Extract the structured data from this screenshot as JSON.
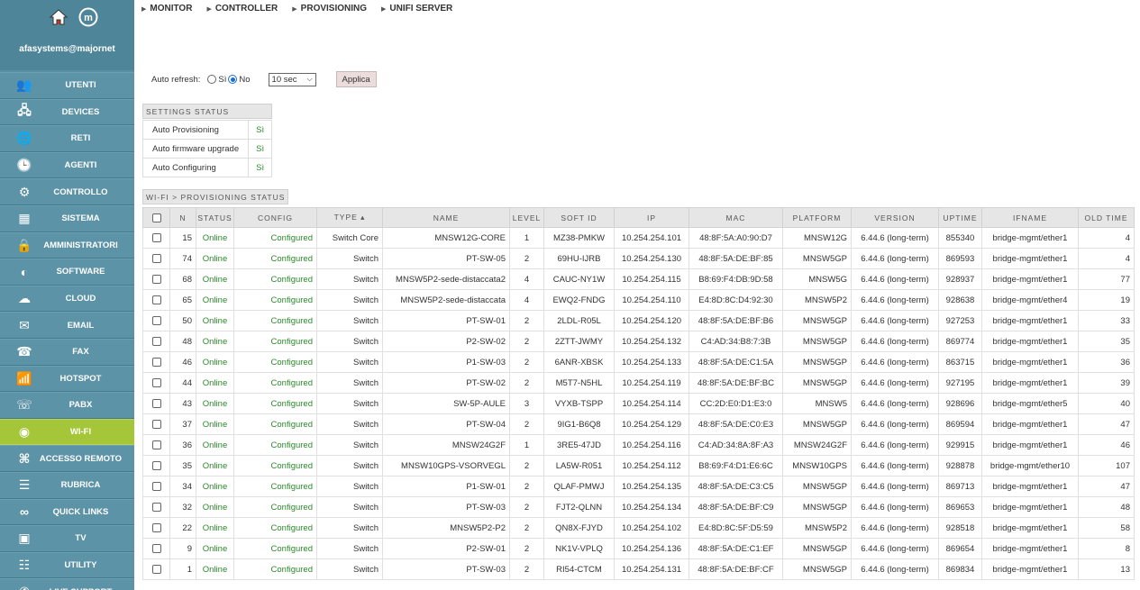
{
  "sidebar": {
    "user": "afasystems@majornet",
    "items": [
      {
        "label": "UTENTI",
        "icon": "users-icon"
      },
      {
        "label": "DEVICES",
        "icon": "devices-icon"
      },
      {
        "label": "RETI",
        "icon": "globe-icon"
      },
      {
        "label": "AGENTI",
        "icon": "clock-icon"
      },
      {
        "label": "CONTROLLO",
        "icon": "control-icon"
      },
      {
        "label": "SISTEMA",
        "icon": "system-icon"
      },
      {
        "label": "AMMINISTRATORI",
        "icon": "lock-icon"
      },
      {
        "label": "SOFTWARE",
        "icon": "software-icon"
      },
      {
        "label": "CLOUD",
        "icon": "cloud-icon"
      },
      {
        "label": "EMAIL",
        "icon": "email-icon"
      },
      {
        "label": "FAX",
        "icon": "fax-icon"
      },
      {
        "label": "HOTSPOT",
        "icon": "hotspot-icon"
      },
      {
        "label": "PABX",
        "icon": "phone-icon"
      },
      {
        "label": "WI-FI",
        "icon": "wifi-icon",
        "active": true
      },
      {
        "label": "ACCESSO REMOTO",
        "icon": "remote-icon"
      },
      {
        "label": "RUBRICA",
        "icon": "contacts-icon"
      },
      {
        "label": "QUICK LINKS",
        "icon": "link-icon"
      },
      {
        "label": "TV",
        "icon": "tv-icon"
      },
      {
        "label": "UTILITY",
        "icon": "utility-icon"
      },
      {
        "label": "LIVE SUPPORT",
        "icon": "support-icon"
      }
    ]
  },
  "topmenu": [
    "MONITOR",
    "CONTROLLER",
    "PROVISIONING",
    "UNIFI SERVER"
  ],
  "refresh": {
    "label": "Auto refresh:",
    "opt_yes": "Sì",
    "opt_no": "No",
    "selected": "No",
    "interval": "10 sec",
    "apply": "Applica"
  },
  "settings": {
    "title": "SETTINGS STATUS",
    "rows": [
      {
        "label": "Auto Provisioning",
        "value": "Sì"
      },
      {
        "label": "Auto firmware upgrade",
        "value": "Sì"
      },
      {
        "label": "Auto Configuring",
        "value": "Sì"
      }
    ]
  },
  "provisioning": {
    "title": "WI-FI > PROVISIONING STATUS",
    "columns": [
      "N",
      "STATUS",
      "CONFIG",
      "TYPE ▴",
      "NAME",
      "LEVEL",
      "SOFT ID",
      "IP",
      "MAC",
      "PLATFORM",
      "VERSION",
      "UPTIME",
      "IFNAME",
      "OLD TIME"
    ],
    "rows": [
      [
        "15",
        "Online",
        "Configured",
        "Switch Core",
        "MNSW12G-CORE",
        "1",
        "MZ38-PMKW",
        "10.254.254.101",
        "48:8F:5A:A0:90:D7",
        "MNSW12G",
        "6.44.6 (long-term)",
        "855340",
        "bridge-mgmt/ether1",
        "4"
      ],
      [
        "74",
        "Online",
        "Configured",
        "Switch",
        "PT-SW-05",
        "2",
        "69HU-IJRB",
        "10.254.254.130",
        "48:8F:5A:DE:BF:85",
        "MNSW5GP",
        "6.44.6 (long-term)",
        "869593",
        "bridge-mgmt/ether1",
        "4"
      ],
      [
        "68",
        "Online",
        "Configured",
        "Switch",
        "MNSW5P2-sede-distaccata2",
        "4",
        "CAUC-NY1W",
        "10.254.254.115",
        "B8:69:F4:DB:9D:58",
        "MNSW5G",
        "6.44.6 (long-term)",
        "928937",
        "bridge-mgmt/ether1",
        "77"
      ],
      [
        "65",
        "Online",
        "Configured",
        "Switch",
        "MNSW5P2-sede-distaccata",
        "4",
        "EWQ2-FNDG",
        "10.254.254.110",
        "E4:8D:8C:D4:92:30",
        "MNSW5P2",
        "6.44.6 (long-term)",
        "928638",
        "bridge-mgmt/ether4",
        "19"
      ],
      [
        "50",
        "Online",
        "Configured",
        "Switch",
        "PT-SW-01",
        "2",
        "2LDL-R05L",
        "10.254.254.120",
        "48:8F:5A:DE:BF:B6",
        "MNSW5GP",
        "6.44.6 (long-term)",
        "927253",
        "bridge-mgmt/ether1",
        "33"
      ],
      [
        "48",
        "Online",
        "Configured",
        "Switch",
        "P2-SW-02",
        "2",
        "2ZTT-JWMY",
        "10.254.254.132",
        "C4:AD:34:B8:7:3B",
        "MNSW5GP",
        "6.44.6 (long-term)",
        "869774",
        "bridge-mgmt/ether1",
        "35"
      ],
      [
        "46",
        "Online",
        "Configured",
        "Switch",
        "P1-SW-03",
        "2",
        "6ANR-XBSK",
        "10.254.254.133",
        "48:8F:5A:DE:C1:5A",
        "MNSW5GP",
        "6.44.6 (long-term)",
        "863715",
        "bridge-mgmt/ether1",
        "36"
      ],
      [
        "44",
        "Online",
        "Configured",
        "Switch",
        "PT-SW-02",
        "2",
        "M5T7-N5HL",
        "10.254.254.119",
        "48:8F:5A:DE:BF:BC",
        "MNSW5GP",
        "6.44.6 (long-term)",
        "927195",
        "bridge-mgmt/ether1",
        "39"
      ],
      [
        "43",
        "Online",
        "Configured",
        "Switch",
        "SW-5P-AULE",
        "3",
        "VYXB-TSPP",
        "10.254.254.114",
        "CC:2D:E0:D1:E3:0",
        "MNSW5",
        "6.44.6 (long-term)",
        "928696",
        "bridge-mgmt/ether5",
        "40"
      ],
      [
        "37",
        "Online",
        "Configured",
        "Switch",
        "PT-SW-04",
        "2",
        "9IG1-B6Q8",
        "10.254.254.129",
        "48:8F:5A:DE:C0:E3",
        "MNSW5GP",
        "6.44.6 (long-term)",
        "869594",
        "bridge-mgmt/ether1",
        "47"
      ],
      [
        "36",
        "Online",
        "Configured",
        "Switch",
        "MNSW24G2F",
        "1",
        "3RE5-47JD",
        "10.254.254.116",
        "C4:AD:34:8A:8F:A3",
        "MNSW24G2F",
        "6.44.6 (long-term)",
        "929915",
        "bridge-mgmt/ether1",
        "46"
      ],
      [
        "35",
        "Online",
        "Configured",
        "Switch",
        "MNSW10GPS-VSORVEGL",
        "2",
        "LA5W-R051",
        "10.254.254.112",
        "B8:69:F4:D1:E6:6C",
        "MNSW10GPS",
        "6.44.6 (long-term)",
        "928878",
        "bridge-mgmt/ether10",
        "107"
      ],
      [
        "34",
        "Online",
        "Configured",
        "Switch",
        "P1-SW-01",
        "2",
        "QLAF-PMWJ",
        "10.254.254.135",
        "48:8F:5A:DE:C3:C5",
        "MNSW5GP",
        "6.44.6 (long-term)",
        "869713",
        "bridge-mgmt/ether1",
        "47"
      ],
      [
        "32",
        "Online",
        "Configured",
        "Switch",
        "PT-SW-03",
        "2",
        "FJT2-QLNN",
        "10.254.254.134",
        "48:8F:5A:DE:BF:C9",
        "MNSW5GP",
        "6.44.6 (long-term)",
        "869653",
        "bridge-mgmt/ether1",
        "48"
      ],
      [
        "22",
        "Online",
        "Configured",
        "Switch",
        "MNSW5P2-P2",
        "2",
        "QN8X-FJYD",
        "10.254.254.102",
        "E4:8D:8C:5F:D5:59",
        "MNSW5P2",
        "6.44.6 (long-term)",
        "928518",
        "bridge-mgmt/ether1",
        "58"
      ],
      [
        "9",
        "Online",
        "Configured",
        "Switch",
        "P2-SW-01",
        "2",
        "NK1V-VPLQ",
        "10.254.254.136",
        "48:8F:5A:DE:C1:EF",
        "MNSW5GP",
        "6.44.6 (long-term)",
        "869654",
        "bridge-mgmt/ether1",
        "8"
      ],
      [
        "1",
        "Online",
        "Configured",
        "Switch",
        "PT-SW-03",
        "2",
        "RI54-CTCM",
        "10.254.254.131",
        "48:8F:5A:DE:BF:CF",
        "MNSW5GP",
        "6.44.6 (long-term)",
        "869834",
        "bridge-mgmt/ether1",
        "13"
      ]
    ]
  },
  "colors": {
    "sidebar": "#5a8fa3",
    "active": "#a6c63a",
    "green": "#2a8a2a"
  }
}
